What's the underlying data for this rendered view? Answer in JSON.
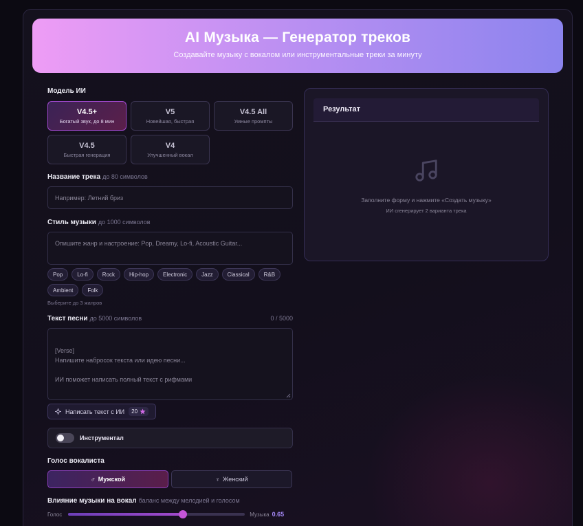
{
  "header": {
    "title": "AI Музыка — Генератор треков",
    "subtitle": "Создавайте музыку с вокалом или инструментальные треки за минуту"
  },
  "model": {
    "label": "Модель ИИ",
    "options": [
      {
        "title": "V4.5+",
        "desc": "Богатый звук, до 8 мин",
        "selected": true
      },
      {
        "title": "V5",
        "desc": "Новейшая, быстрая",
        "selected": false
      },
      {
        "title": "V4.5 All",
        "desc": "Умные промпты",
        "selected": false
      },
      {
        "title": "V4.5",
        "desc": "Быстрая генерация",
        "selected": false
      },
      {
        "title": "V4",
        "desc": "Улучшенный вокал",
        "selected": false
      }
    ]
  },
  "track_name": {
    "label": "Название трека",
    "hint": "до 80 символов",
    "placeholder": "Например: Летний бриз"
  },
  "style": {
    "label": "Стиль музыки",
    "hint": "до 1000 символов",
    "placeholder": "Опишите жанр и настроение: Pop, Dreamy, Lo-fi, Acoustic Guitar...",
    "tags": [
      "Pop",
      "Lo-fi",
      "Rock",
      "Hip-hop",
      "Electronic",
      "Jazz",
      "Classical",
      "R&B",
      "Ambient",
      "Folk"
    ],
    "tags_hint": "Выберите до 3 жанров"
  },
  "lyrics": {
    "label": "Текст песни",
    "hint": "до 5000 символов",
    "counter": "0 / 5000",
    "placeholder": "[Verse]\nНапишите набросок текста или идею песни...\n\nИИ поможет написать полный текст с рифмами",
    "ai_button": "Написать текст с ИИ",
    "ai_cost": "20"
  },
  "instrumental": {
    "label": "Инструментал",
    "enabled": false
  },
  "voice": {
    "label": "Голос вокалиста",
    "options": [
      {
        "label": "Мужской",
        "icon": "male-icon",
        "selected": true
      },
      {
        "label": "Женский",
        "icon": "female-icon",
        "selected": false
      }
    ]
  },
  "influence": {
    "label": "Влияние музыки на вокал",
    "hint": "баланс между мелодией и голосом",
    "left": "Голос",
    "right": "Музыка",
    "value": 0.65,
    "value_text": "0.65"
  },
  "result": {
    "title": "Результат",
    "icon": "music-note-icon",
    "line1": "Заполните форму и нажмите «Создать музыку»",
    "line2": "ИИ сгенерирует 2 варианта трека"
  },
  "colors": {
    "accent": "#a78bfa",
    "banner_start": "#ee9cf5",
    "banner_end": "#8c84ee"
  }
}
